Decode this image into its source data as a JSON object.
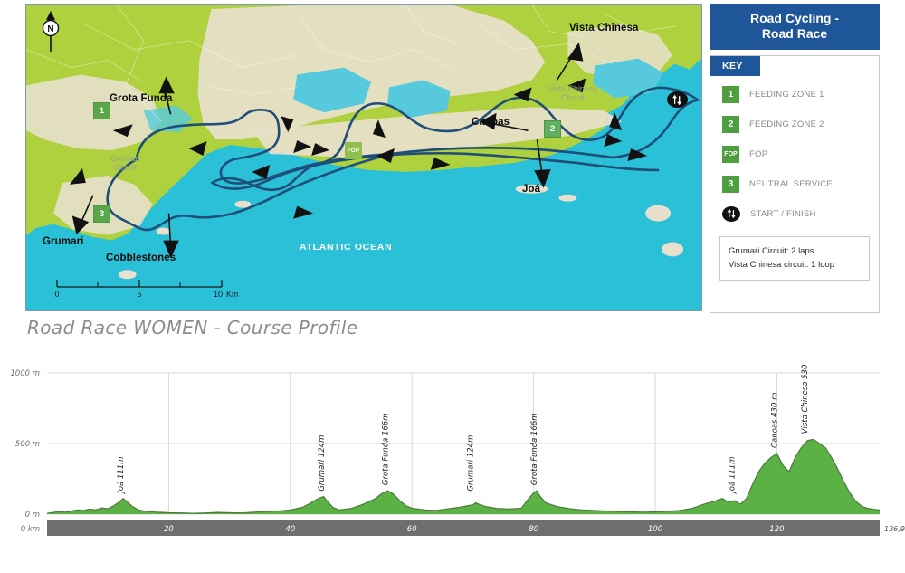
{
  "legend": {
    "title_line1": "Road Cycling -",
    "title_line2": "Road Race",
    "key_header": "KEY",
    "items": [
      {
        "marker": "1",
        "label": "FEEDING ZONE 1"
      },
      {
        "marker": "2",
        "label": "FEEDING ZONE 2"
      },
      {
        "marker": "FOP",
        "label": "FOP"
      },
      {
        "marker": "3",
        "label": "NEUTRAL SERVICE"
      },
      {
        "marker": "",
        "label": "START / FINISH"
      }
    ],
    "notes": [
      "Grumari Circuit: 2 laps",
      "Vista Chinesa circuit: 1 loop"
    ]
  },
  "map": {
    "compass_label": "N",
    "ocean_label": "ATLANTIC OCEAN",
    "circuit_labels": [
      {
        "line1": "Grumari",
        "line2": "Circuit"
      },
      {
        "line1": "Vista Chinesa",
        "line2": "Circuit"
      }
    ],
    "place_labels": [
      "Grota Funda",
      "Grumari",
      "Cobblestones",
      "Vista Chinesa",
      "Canoas",
      "Joá"
    ],
    "markers": [
      {
        "text": "1"
      },
      {
        "text": "3"
      },
      {
        "text": "FOP"
      },
      {
        "text": "2"
      }
    ],
    "scale": {
      "ticks": [
        "0",
        "5",
        "10"
      ],
      "unit": "Km"
    },
    "colors": {
      "land": "#aed13d",
      "ocean": "#29c0d8",
      "urban": "#e8e0cc",
      "route": "#1f4e79",
      "marker_green": "#5aa74a",
      "header_blue": "#1f5699"
    }
  },
  "profile": {
    "title": "Road Race WOMEN - Course Profile"
  },
  "chart_data": {
    "type": "area",
    "title": "Road Race WOMEN - Course Profile",
    "xlabel": "0 km",
    "ylabel": "m",
    "xlim": [
      0,
      136.9
    ],
    "ylim": [
      0,
      1000
    ],
    "x_start_label": "0 km",
    "x_end_label": "136,9 km",
    "xticks": [
      20,
      40,
      60,
      80,
      100,
      120
    ],
    "xtick_labels": [
      "20",
      "40",
      "60",
      "80",
      "100",
      "120"
    ],
    "yticks": [
      0,
      500,
      1000
    ],
    "ytick_labels": [
      "0 m",
      "500 m",
      "1000 m"
    ],
    "grid": true,
    "legend": "none",
    "area_color": "#5cb145",
    "line_color": "#4b7a3a",
    "annotations": [
      {
        "label": "Joá 111m",
        "x": 12.5,
        "y": 111
      },
      {
        "label": "Grumari 124m",
        "x": 45.5,
        "y": 124
      },
      {
        "label": "Grota Funda 166m",
        "x": 56.0,
        "y": 166
      },
      {
        "label": "Grumari 124m",
        "x": 70.0,
        "y": 124
      },
      {
        "label": "Grota Funda 166m",
        "x": 80.5,
        "y": 166
      },
      {
        "label": "Joá 111m",
        "x": 113.0,
        "y": 111
      },
      {
        "label": "Canoas 430 m",
        "x": 120.0,
        "y": 430
      },
      {
        "label": "Vista Chinesa 530 m",
        "x": 125.0,
        "y": 530
      }
    ],
    "x": [
      0,
      1,
      2,
      3,
      4,
      5,
      6,
      7,
      8,
      9,
      10,
      11,
      12,
      12.5,
      13,
      14,
      15,
      16,
      17,
      18,
      19,
      20,
      22,
      24,
      26,
      28,
      30,
      32,
      34,
      36,
      38,
      40,
      42,
      43,
      44,
      45,
      45.5,
      46,
      47,
      48,
      50,
      52,
      54,
      55,
      56,
      57,
      58,
      59,
      60,
      62,
      64,
      66,
      68,
      70,
      70.5,
      71,
      72,
      74,
      76,
      78,
      79,
      80,
      80.5,
      81,
      82,
      84,
      86,
      88,
      90,
      92,
      94,
      96,
      98,
      100,
      102,
      104,
      106,
      108,
      110,
      111,
      112,
      113,
      114,
      115,
      116,
      117,
      118,
      119,
      120,
      121,
      122,
      123,
      124,
      125,
      126,
      127,
      128,
      129,
      130,
      131,
      132,
      133,
      134,
      135,
      136,
      136.9
    ],
    "y": [
      5,
      12,
      18,
      14,
      22,
      30,
      26,
      36,
      30,
      44,
      38,
      60,
      90,
      111,
      95,
      55,
      30,
      22,
      18,
      14,
      12,
      10,
      8,
      6,
      8,
      12,
      10,
      8,
      14,
      18,
      22,
      30,
      48,
      70,
      96,
      118,
      124,
      95,
      48,
      30,
      40,
      70,
      110,
      145,
      166,
      140,
      95,
      60,
      42,
      30,
      26,
      38,
      50,
      66,
      80,
      70,
      55,
      40,
      36,
      42,
      100,
      150,
      166,
      130,
      80,
      52,
      38,
      30,
      26,
      22,
      18,
      16,
      14,
      16,
      20,
      26,
      40,
      70,
      95,
      111,
      86,
      96,
      70,
      110,
      210,
      300,
      360,
      400,
      430,
      345,
      300,
      400,
      470,
      520,
      530,
      500,
      470,
      400,
      320,
      230,
      150,
      90,
      55,
      40,
      34,
      30,
      28,
      26
    ]
  }
}
